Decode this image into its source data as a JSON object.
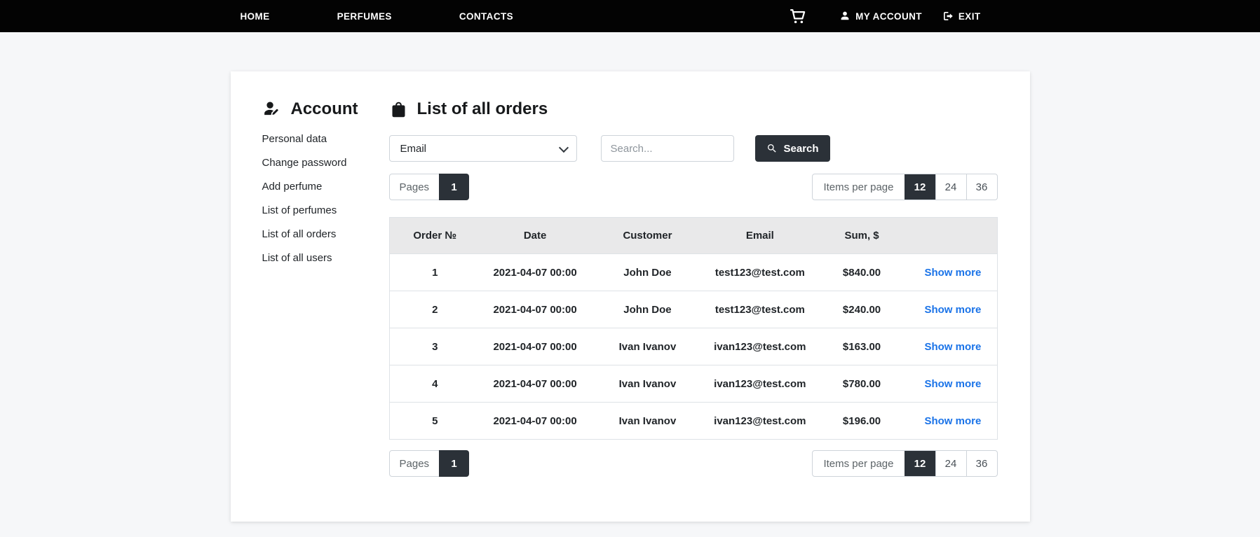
{
  "nav": {
    "links": [
      {
        "label": "HOME"
      },
      {
        "label": "PERFUMES"
      },
      {
        "label": "CONTACTS"
      }
    ],
    "my_account_label": "MY ACCOUNT",
    "exit_label": "EXIT"
  },
  "sidebar": {
    "title": "Account",
    "items": [
      {
        "label": "Personal data"
      },
      {
        "label": "Change password"
      },
      {
        "label": "Add perfume"
      },
      {
        "label": "List of perfumes"
      },
      {
        "label": "List of all orders"
      },
      {
        "label": "List of all users"
      }
    ]
  },
  "main": {
    "title": "List of all orders",
    "filter": {
      "selected_field": "Email",
      "search_placeholder": "Search...",
      "search_button_label": "Search"
    },
    "pagination": {
      "pages_label": "Pages",
      "active_page": "1",
      "items_per_page_label": "Items per page",
      "options": [
        "12",
        "24",
        "36"
      ],
      "active_option": "12"
    },
    "table": {
      "headers": [
        "Order №",
        "Date",
        "Customer",
        "Email",
        "Sum, $",
        ""
      ],
      "rows": [
        {
          "order": "1",
          "date": "2021-04-07 00:00",
          "customer": "John Doe",
          "email": "test123@test.com",
          "sum": "$840.00",
          "action": "Show more"
        },
        {
          "order": "2",
          "date": "2021-04-07 00:00",
          "customer": "John Doe",
          "email": "test123@test.com",
          "sum": "$240.00",
          "action": "Show more"
        },
        {
          "order": "3",
          "date": "2021-04-07 00:00",
          "customer": "Ivan Ivanov",
          "email": "ivan123@test.com",
          "sum": "$163.00",
          "action": "Show more"
        },
        {
          "order": "4",
          "date": "2021-04-07 00:00",
          "customer": "Ivan Ivanov",
          "email": "ivan123@test.com",
          "sum": "$780.00",
          "action": "Show more"
        },
        {
          "order": "5",
          "date": "2021-04-07 00:00",
          "customer": "Ivan Ivanov",
          "email": "ivan123@test.com",
          "sum": "$196.00",
          "action": "Show more"
        }
      ]
    }
  },
  "colors": {
    "nav_bg": "#030303",
    "accent_dark": "#2b3138",
    "link_blue": "#1a73e8",
    "table_header_bg": "#e9e9ea",
    "page_bg": "#f6f7f9"
  }
}
